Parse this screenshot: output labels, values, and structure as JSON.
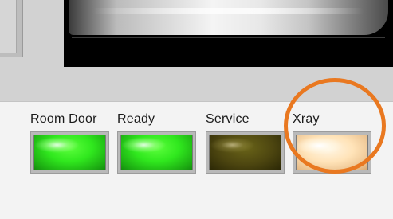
{
  "indicators": [
    {
      "label": "Room Door",
      "state": "on",
      "color": "#3df02a"
    },
    {
      "label": "Ready",
      "state": "on",
      "color": "#3df02a"
    },
    {
      "label": "Service",
      "state": "off",
      "color": "#4d4610"
    },
    {
      "label": "Xray",
      "state": "off",
      "color": "#ffe3b8"
    }
  ],
  "annotation": {
    "color": "#e97820"
  }
}
